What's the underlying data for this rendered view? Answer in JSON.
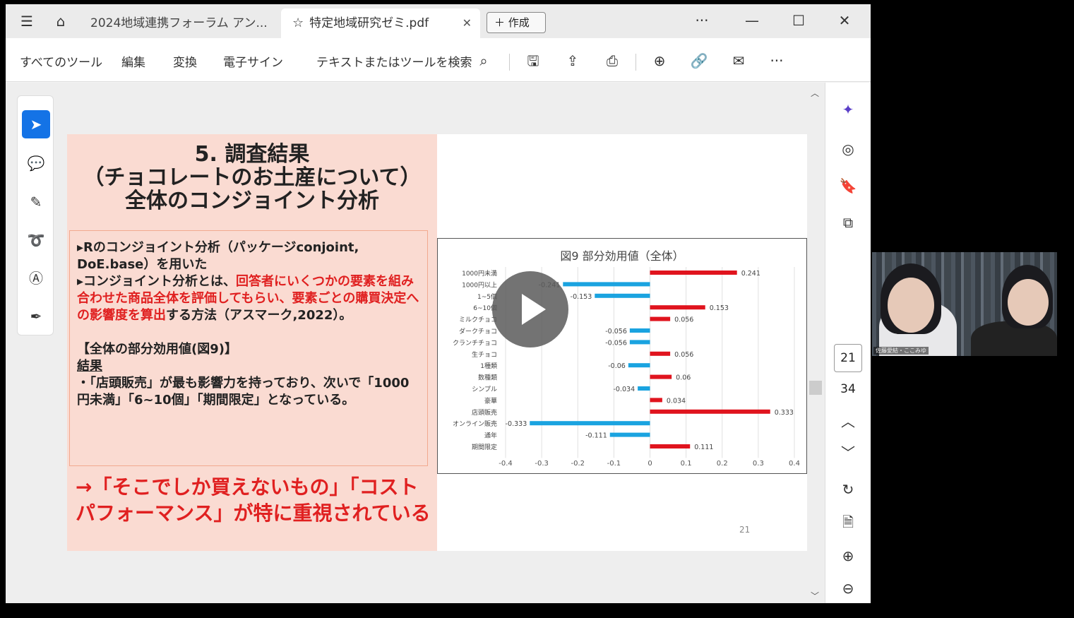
{
  "tabs": {
    "inactive_label": "2024地域連携フォーラム アン...",
    "active_label": "特定地域研究ゼミ.pdf",
    "create_label": "作成"
  },
  "toolbar": {
    "menu": [
      "すべてのツール",
      "編集",
      "変換",
      "電子サイン"
    ],
    "search_label": "テキストまたはツールを検索"
  },
  "slide": {
    "title_lines": [
      "5. 調査結果",
      "（チョコレートのお土産について）",
      "全体のコンジョイント分析"
    ],
    "bullet1": "▸Rのコンジョイント分析（パッケージconjoint, DoE.base）を用いた",
    "bullet2_a": "▸コンジョイント分析とは、",
    "bullet2_red": "回答者にいくつかの要素を組み合わせた商品全体を評価してもらい、要素ごとの購買決定への影響度を算出",
    "bullet2_b": "する方法（アスマーク,2022）。",
    "section_heading": "【全体の部分効用値(図9)】",
    "result_heading": "結果",
    "result_text": "・「店頭販売」が最も影響力を持っており、次いで「1000円未満」「6~10個」「期間限定」となっている。",
    "conclusion": "→「そこでしか買えないもの」「コストパフォーマンス」が特に重視されている",
    "page_number": "21"
  },
  "chart_data": {
    "type": "bar",
    "orientation": "horizontal",
    "title": "図9 部分効用値（全体）",
    "categories": [
      "1000円未満",
      "1000円以上",
      "1~5個",
      "6~10個",
      "ミルクチョコ",
      "ダークチョコ",
      "クランチチョコ",
      "生チョコ",
      "1種類",
      "数種類",
      "シンプル",
      "豪華",
      "店頭販売",
      "オンライン販売",
      "通年",
      "期間限定"
    ],
    "values": [
      0.241,
      -0.241,
      -0.153,
      0.153,
      0.056,
      -0.056,
      -0.056,
      0.056,
      -0.06,
      0.06,
      -0.034,
      0.034,
      0.333,
      -0.333,
      -0.111,
      0.111
    ],
    "value_labels": [
      "0.241",
      "-0.241",
      "-0.153",
      "0.153",
      "0.056",
      "-0.056",
      "-0.056",
      "0.056",
      "-0.06",
      "0.06",
      "-0.034",
      "0.034",
      "0.333",
      "-0.333",
      "-0.111",
      "0.111"
    ],
    "xlim": [
      -0.4,
      0.4
    ],
    "xticks": [
      "-0.4",
      "-0.3",
      "-0.2",
      "-0.1",
      "0",
      "0.1",
      "0.2",
      "0.3",
      "0.4"
    ],
    "positive_color": "#e0141e",
    "negative_color": "#1aa3e0",
    "grid": true
  },
  "rightrail": {
    "current_page": "21",
    "total_pages": "34"
  },
  "video": {
    "name_label": "佐藤愛結・ここみゆ"
  }
}
